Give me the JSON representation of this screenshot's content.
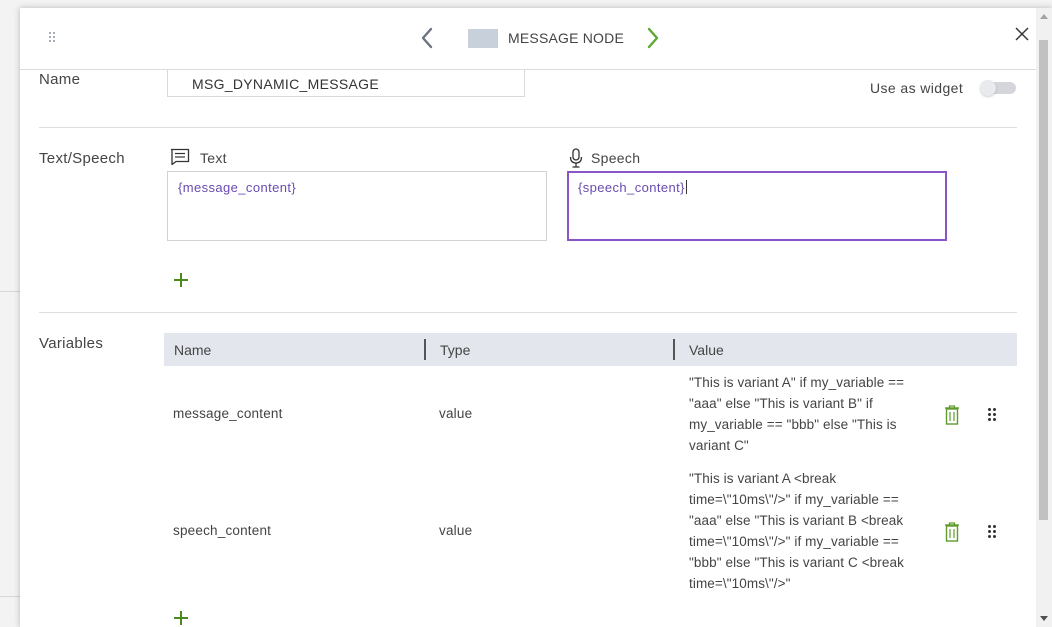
{
  "header": {
    "node_title": "MESSAGE NODE",
    "colors": {
      "swatch": "#c8d1db",
      "next_arrow": "#5fa82f",
      "prev_arrow": "#6b7480"
    }
  },
  "name_section": {
    "label": "Name",
    "value": "MSG_DYNAMIC_MESSAGE",
    "widget_label": "Use as widget",
    "widget_enabled": false
  },
  "text_speech_section": {
    "label": "Text/Speech",
    "text_label": "Text",
    "text_value": "{message_content}",
    "speech_label": "Speech",
    "speech_value": "{speech_content}",
    "accent_color": "#8a55c8"
  },
  "variables_section": {
    "label": "Variables",
    "columns": [
      "Name",
      "Type",
      "Value"
    ],
    "rows": [
      {
        "name": "message_content",
        "type": "value",
        "value_lines": [
          "\"This is variant A\" if my_variable ==",
          "\"aaa\" else \"This is variant B\" if",
          "my_variable == \"bbb\" else \"This is",
          "variant C\""
        ]
      },
      {
        "name": "speech_content",
        "type": "value",
        "value_lines": [
          "\"This is variant A <break",
          "time=\\\"10ms\\\"/>\" if my_variable ==",
          "\"aaa\" else \"This is variant B <break",
          "time=\\\"10ms\\\"/>\" if my_variable ==",
          "\"bbb\" else \"This is variant C <break",
          "time=\\\"10ms\\\"/>\""
        ]
      }
    ]
  },
  "icons": {
    "drag": "drag-handle-icon",
    "prev": "chevron-left-icon",
    "next": "chevron-right-icon",
    "close": "close-icon",
    "text": "message-icon",
    "speech": "microphone-icon",
    "add": "plus-icon",
    "delete": "trash-icon",
    "reorder": "grip-icon"
  }
}
